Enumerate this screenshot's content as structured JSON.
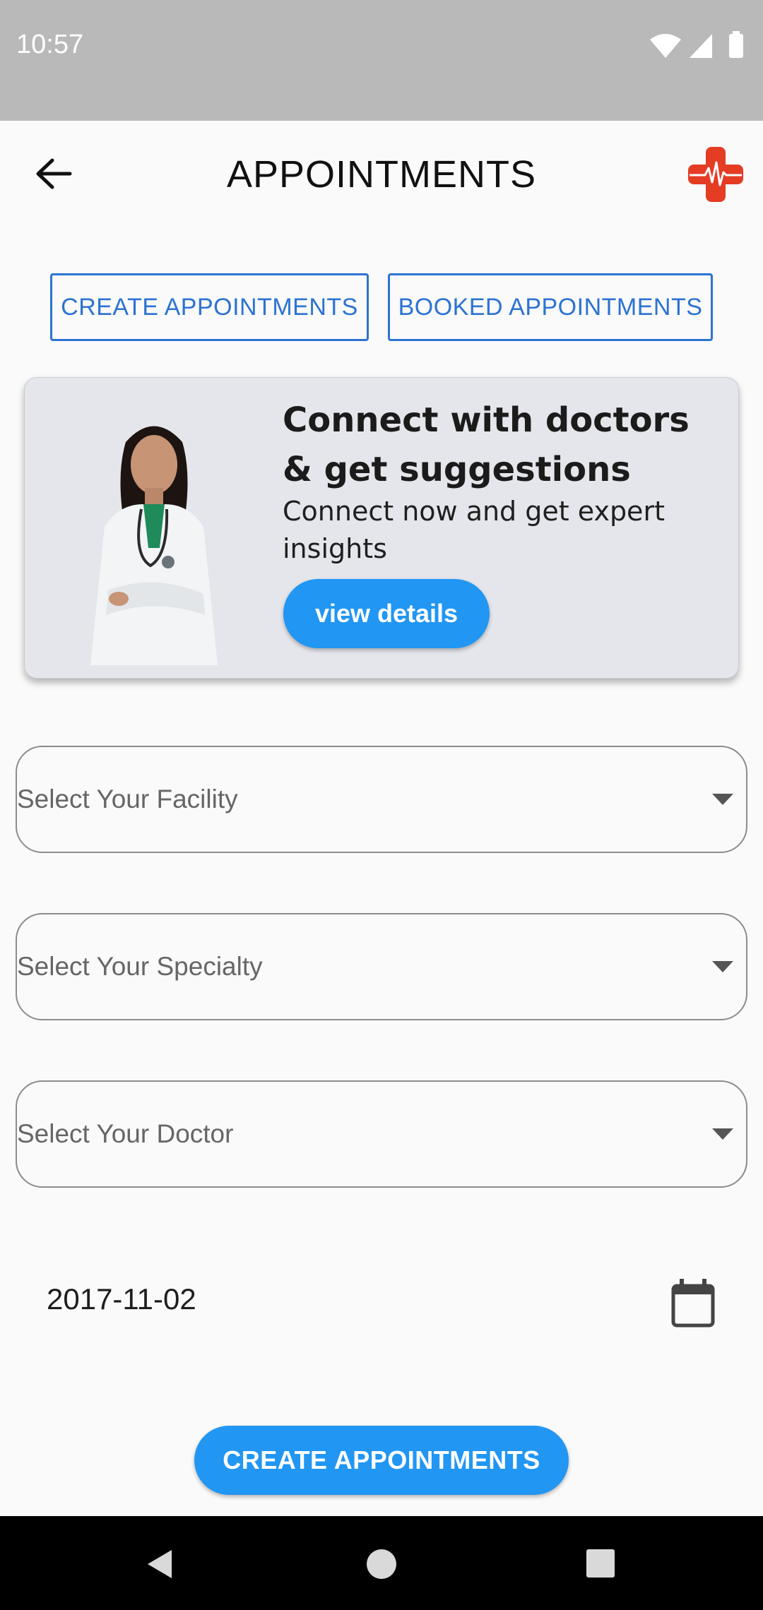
{
  "status_bar": {
    "time": "10:57"
  },
  "app_bar": {
    "title": "APPOINTMENTS"
  },
  "tabs": {
    "create_label": "CREATE APPOINTMENTS",
    "booked_label": "BOOKED APPOINTMENTS"
  },
  "banner": {
    "title": "Connect with doctors & get suggestions",
    "subtitle": "Connect now and get expert insights",
    "button_label": "view details"
  },
  "form": {
    "facility_placeholder": "Select Your Facility",
    "specialty_placeholder": "Select Your Specialty",
    "doctor_placeholder": "Select Your Doctor",
    "date_value": "2017-11-02",
    "submit_label": "CREATE APPOINTMENTS"
  },
  "icons": {
    "back": "arrow-left-icon",
    "logo": "medical-cross-heartbeat-icon",
    "dropdown": "caret-down-icon",
    "calendar": "calendar-icon",
    "nav_back": "triangle-back-icon",
    "nav_home": "circle-home-icon",
    "nav_recents": "square-recents-icon"
  },
  "colors": {
    "accent": "#2196f3",
    "outline": "#2c73d2",
    "logo": "#e53c24",
    "status_bar": "#b9b9b9",
    "banner_bg": "#e4e6eb"
  }
}
